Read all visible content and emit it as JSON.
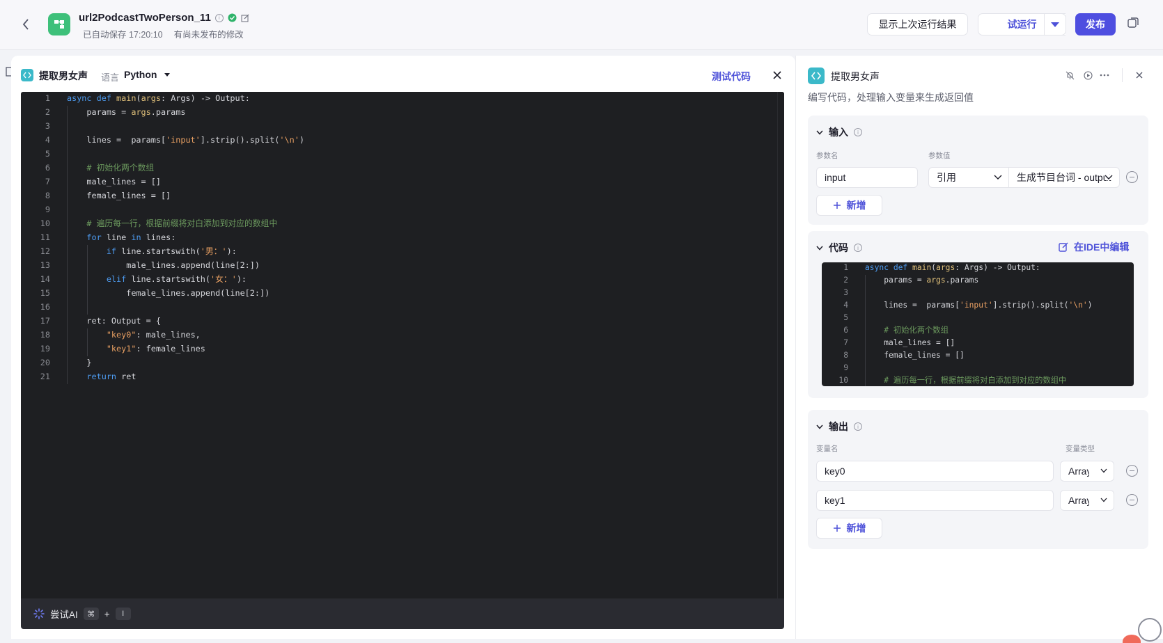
{
  "header": {
    "title": "url2PodcastTwoPerson_11",
    "autosave": "已自动保存 17:20:10",
    "unpublished": "有尚未发布的修改",
    "btn_last_result": "显示上次运行结果",
    "btn_trial": "试运行",
    "btn_publish": "发布"
  },
  "editor": {
    "title": "提取男女声",
    "lang_label": "语言",
    "lang": "Python",
    "test_code": "测试代码",
    "ai_label": "尝试AI",
    "ai_key1": "⌘",
    "ai_plus": "+",
    "ai_key2": "I",
    "lines": [
      "async def main(args: Args) -> Output:",
      "    params = args.params",
      "",
      "    lines =  params['input'].strip().split('\\n')",
      "",
      "    # 初始化两个数组",
      "    male_lines = []",
      "    female_lines = []",
      "",
      "    # 遍历每一行，根据前缀将对白添加到对应的数组中",
      "    for line in lines:",
      "        if line.startswith('男：'):",
      "            male_lines.append(line[2:])",
      "        elif line.startswith('女：'):",
      "            female_lines.append(line[2:])",
      "",
      "    ret: Output = {",
      "        \"key0\": male_lines,",
      "        \"key1\": female_lines",
      "    }",
      "    return ret"
    ]
  },
  "panel": {
    "title": "提取男女声",
    "description": "编写代码，处理输入变量来生成返回值",
    "input": {
      "section_title": "输入",
      "col_name": "参数名",
      "col_value": "参数值",
      "param_name": "input",
      "ref_type": "引用",
      "ref_value": "生成节目台词 - output",
      "add_label": "新增"
    },
    "code": {
      "section_title": "代码",
      "ide_link": "在IDE中编辑"
    },
    "output": {
      "section_title": "输出",
      "col_name": "变量名",
      "col_type": "变量类型",
      "rows": [
        {
          "name": "key0",
          "type": "Array"
        },
        {
          "name": "key1",
          "type": "Array"
        }
      ],
      "add_label": "新增"
    }
  },
  "colors": {
    "accent": "#4e52d9",
    "publish": "#4e4ee0",
    "code_bg": "#1e1f22",
    "app_icon": "#3ec07a",
    "node_icon": "#3bb9c9"
  },
  "icons": [
    "back-arrow-icon",
    "workflow-app-icon",
    "info-icon",
    "check-circle-icon",
    "edit-icon",
    "chevron-down-icon",
    "copy-icon",
    "code-node-icon",
    "close-icon",
    "ai-sparkle-icon",
    "bell-off-icon",
    "play-circle-icon",
    "more-icon",
    "plus-icon",
    "minus-circle-icon"
  ]
}
